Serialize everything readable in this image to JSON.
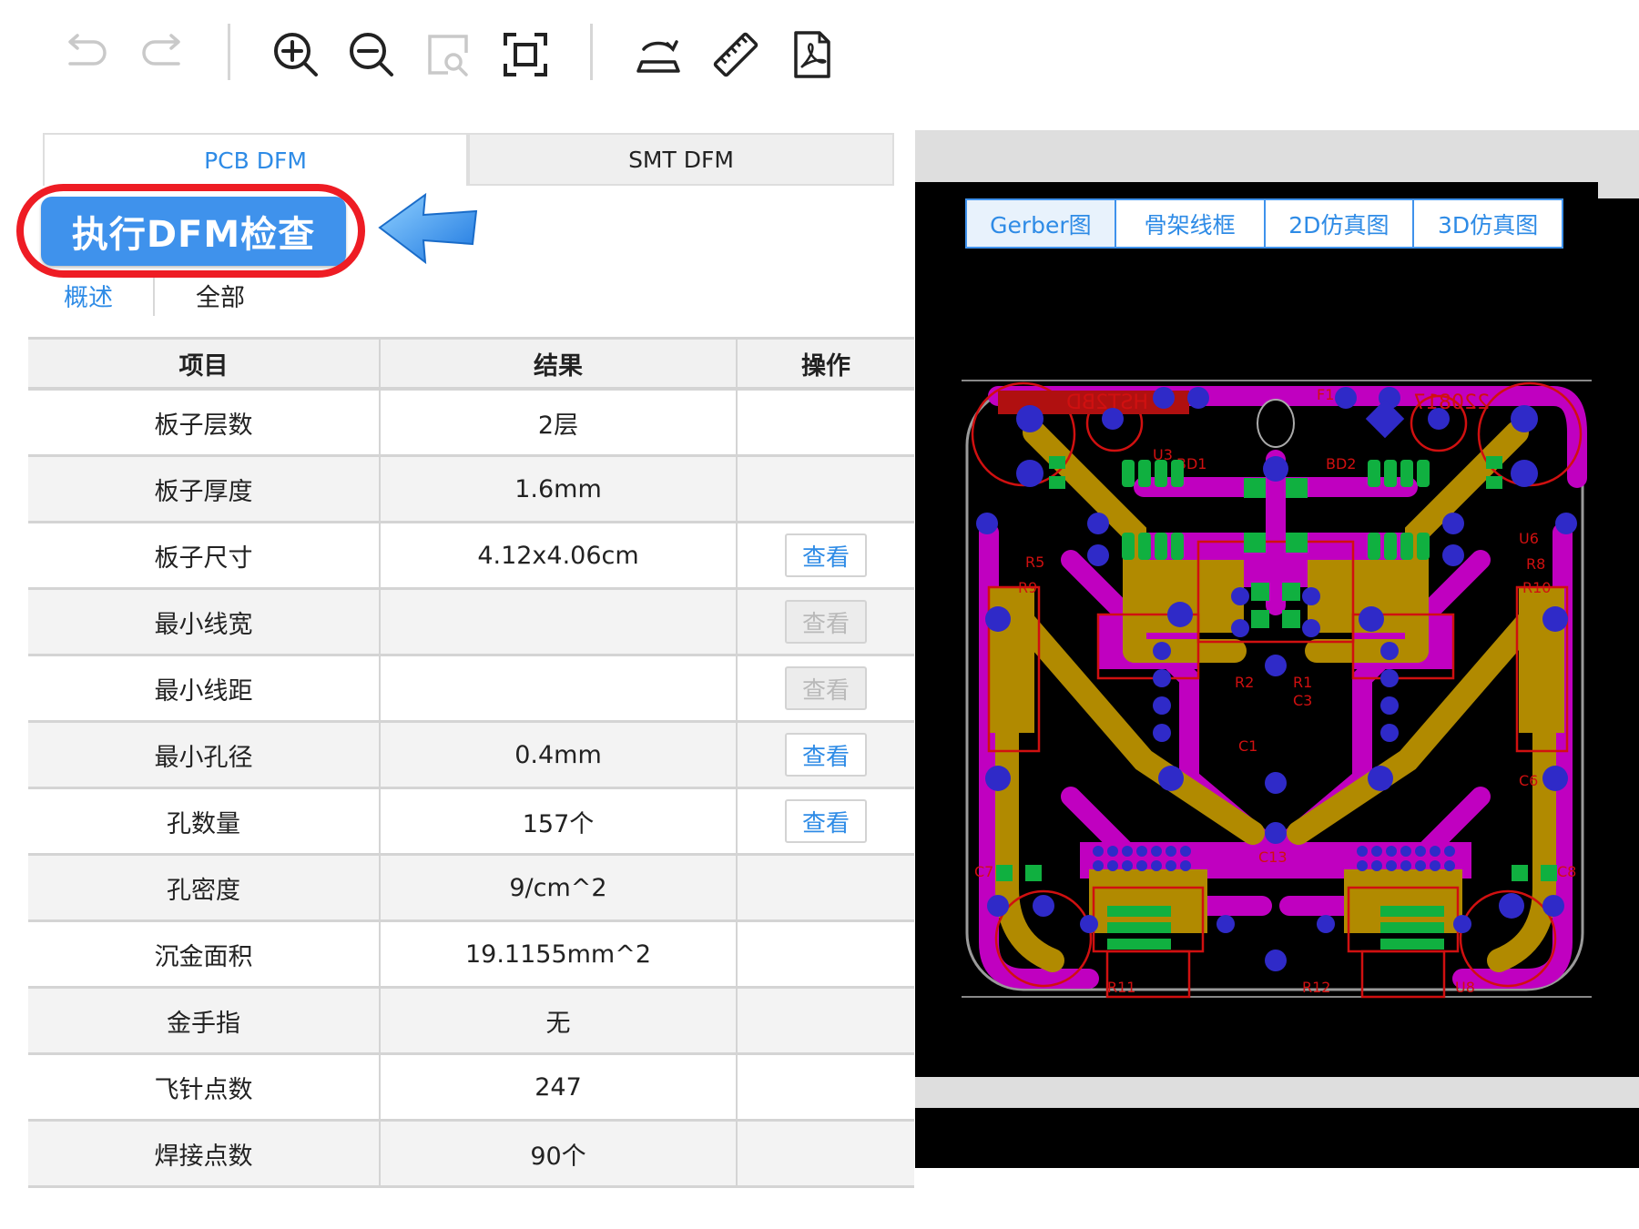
{
  "toolbar": {
    "icons": [
      "undo-icon",
      "redo-icon",
      "zoom-in-icon",
      "zoom-out-icon",
      "zoom-area-icon",
      "fit-screen-icon",
      "flip-board-icon",
      "ruler-icon",
      "pdf-export-icon"
    ]
  },
  "tabs": {
    "pcb": "PCB DFM",
    "smt": "SMT DFM"
  },
  "run_button": "执行DFM检查",
  "subtabs": {
    "overview": "概述",
    "all": "全部"
  },
  "table": {
    "headers": [
      "项目",
      "结果",
      "操作"
    ],
    "rows": [
      {
        "item": "板子层数",
        "result": "2层",
        "action": ""
      },
      {
        "item": "板子厚度",
        "result": "1.6mm",
        "action": ""
      },
      {
        "item": "板子尺寸",
        "result": "4.12x4.06cm",
        "action": "查看"
      },
      {
        "item": "最小线宽",
        "result": "",
        "action": "查看"
      },
      {
        "item": "最小线距",
        "result": "",
        "action": "查看"
      },
      {
        "item": "最小孔径",
        "result": "0.4mm",
        "action": "查看"
      },
      {
        "item": "孔数量",
        "result": "157个",
        "action": "查看"
      },
      {
        "item": "孔密度",
        "result": "9/cm^2",
        "action": ""
      },
      {
        "item": "沉金面积",
        "result": "19.1155mm^2",
        "action": ""
      },
      {
        "item": "金手指",
        "result": "无",
        "action": ""
      },
      {
        "item": "飞针点数",
        "result": "247",
        "action": ""
      },
      {
        "item": "焊接点数",
        "result": "90个",
        "action": ""
      }
    ]
  },
  "viewer": {
    "tabs": [
      "Gerber图",
      "骨架线框",
      "2D仿真图",
      "3D仿真图"
    ],
    "active_tab": "Gerber图",
    "silkscreen": {
      "top_left": "HST2BD",
      "top_right": "220817",
      "fuse": "F1",
      "labels": [
        "U3",
        "BD1",
        "BD2",
        "U6",
        "R5",
        "R8",
        "R9",
        "R10",
        "R2",
        "R1",
        "C3",
        "C1",
        "C13",
        "C6",
        "C7",
        "C8",
        "R11",
        "R12",
        "U8"
      ]
    }
  },
  "colors": {
    "accent": "#2e8be6",
    "button_bg": "#3f92ec",
    "highlight_ring": "#ee1c24",
    "pcb_copper_top": "#b18a00",
    "pcb_copper_bottom": "#c000c0",
    "pcb_pad": "#2f2ac8",
    "pcb_smd": "#10b040",
    "pcb_silk": "#d01010"
  }
}
